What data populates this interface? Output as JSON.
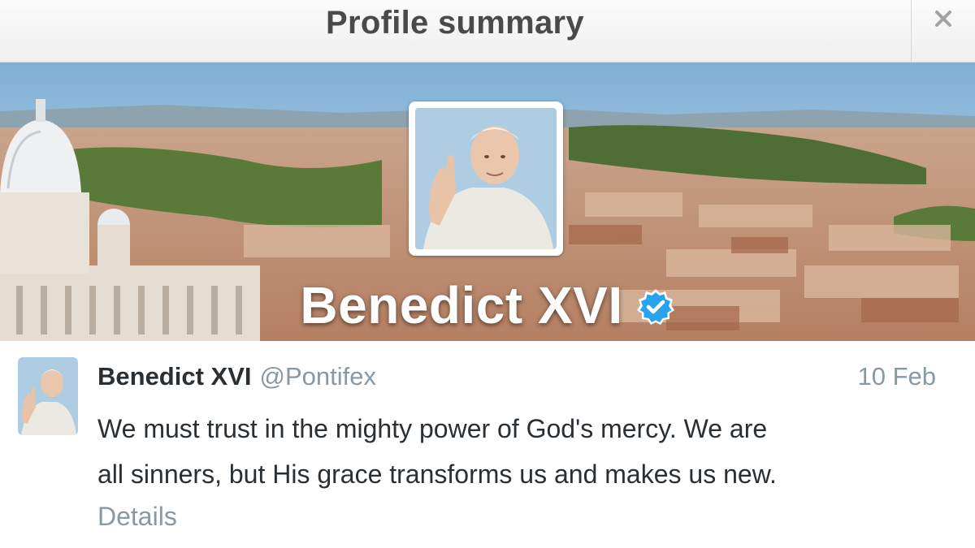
{
  "header": {
    "title": "Profile summary"
  },
  "icons": {
    "close": "close-icon",
    "verified": "verified-badge-icon",
    "avatar": "profile-photo"
  },
  "banner": {
    "name": "Benedict XVI"
  },
  "tweet": {
    "name": "Benedict XVI",
    "handle": "@Pontifex",
    "date": "10 Feb",
    "line1": "We must trust in the mighty power of God's mercy. We are",
    "line2": "all sinners, but His grace transforms us and makes us new.",
    "details": "Details"
  },
  "colors": {
    "verified": "#2aa3ef",
    "name_text": "#292f33",
    "secondary_text": "#8899a6"
  }
}
